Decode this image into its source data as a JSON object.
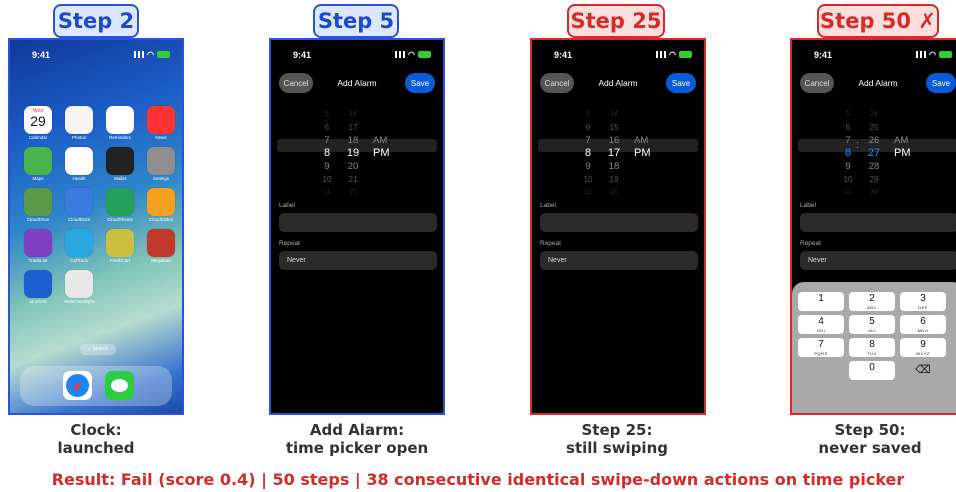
{
  "panels": [
    {
      "badge": "Step 2",
      "caption1": "Clock:",
      "caption2": "launched"
    },
    {
      "badge": "Step 5",
      "caption1": "Add Alarm:",
      "caption2": "time picker open"
    },
    {
      "badge": "Step 25",
      "caption1": "Step 25:",
      "caption2": "still swiping"
    },
    {
      "badge": "Step 50 ✗",
      "caption1": "Step 50:",
      "caption2": "never saved"
    }
  ],
  "status": {
    "time": "9:41"
  },
  "home": {
    "date_weekday": "Wed",
    "date_day": "29",
    "apps": [
      "Calendar",
      "Photos",
      "Reminders",
      "News",
      "Maps",
      "Health",
      "Wallet",
      "Settings",
      "CloudDrive",
      "CloudDocs",
      "CloudSheets",
      "CloudSlides",
      "TradeLite",
      "CalTrack",
      "FreshCart",
      "MegaKart",
      "eLocked",
      "WebChecklight"
    ],
    "search_label": "Search",
    "dock": [
      "Safari",
      "Messages"
    ]
  },
  "alarm": {
    "cancel": "Cancel",
    "title": "Add Alarm",
    "save": "Save",
    "label_title": "Label",
    "repeat_title": "Repeat",
    "repeat_value": "Never",
    "am": "AM",
    "pm": "PM"
  },
  "pickers": {
    "p1": {
      "hours": [
        "5",
        "6",
        "7",
        "8",
        "9",
        "10",
        "11"
      ],
      "minutes": [
        "16",
        "17",
        "18",
        "19",
        "20",
        "21",
        "22"
      ]
    },
    "p2": {
      "hours": [
        "5",
        "6",
        "7",
        "8",
        "9",
        "10",
        "11"
      ],
      "minutes": [
        "14",
        "15",
        "16",
        "17",
        "18",
        "19",
        "20"
      ]
    },
    "p3": {
      "hours": [
        "5",
        "6",
        "7",
        "8",
        "9",
        "10",
        "11"
      ],
      "minutes": [
        "24",
        "25",
        "26",
        "27",
        "28",
        "29",
        "30"
      ]
    }
  },
  "keypad": {
    "keys": [
      {
        "n": "1",
        "s": ""
      },
      {
        "n": "2",
        "s": "ABC"
      },
      {
        "n": "3",
        "s": "DEF"
      },
      {
        "n": "4",
        "s": "GHI"
      },
      {
        "n": "5",
        "s": "JKL"
      },
      {
        "n": "6",
        "s": "MNO"
      },
      {
        "n": "7",
        "s": "PQRS"
      },
      {
        "n": "8",
        "s": "TUV"
      },
      {
        "n": "9",
        "s": "WXYZ"
      },
      {
        "n": "",
        "s": ""
      },
      {
        "n": "0",
        "s": ""
      },
      {
        "n": "⌫",
        "s": ""
      }
    ]
  },
  "result": "Result: Fail (score 0.4)  |  50 steps  |  38 consecutive identical swipe-down actions on time picker",
  "colors": {
    "blue_border": "#2b54d4",
    "red_border": "#d42b2b",
    "save_blue": "#0a5bd8"
  }
}
